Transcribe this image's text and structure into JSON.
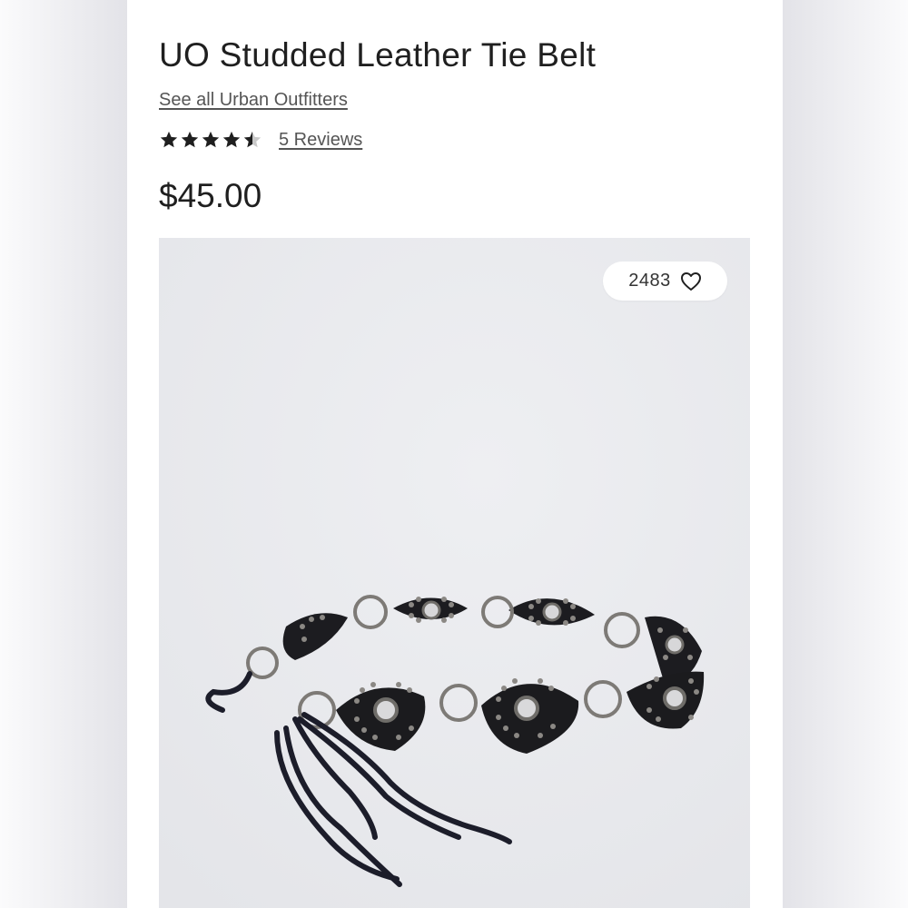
{
  "product": {
    "title": "UO Studded Leather Tie Belt",
    "brand_link": "See all Urban Outfitters",
    "rating": 4.5,
    "reviews_label": "5 Reviews",
    "price": "$45.00"
  },
  "image": {
    "like_count": "2483",
    "icons": [
      "heart-icon",
      "star-icon"
    ]
  },
  "colors": {
    "text": "#1f1f1f",
    "link": "#555555",
    "belt_leather": "#1b1b1e",
    "belt_hardware": "#7d7a76",
    "image_bg": "#e9eaed"
  }
}
